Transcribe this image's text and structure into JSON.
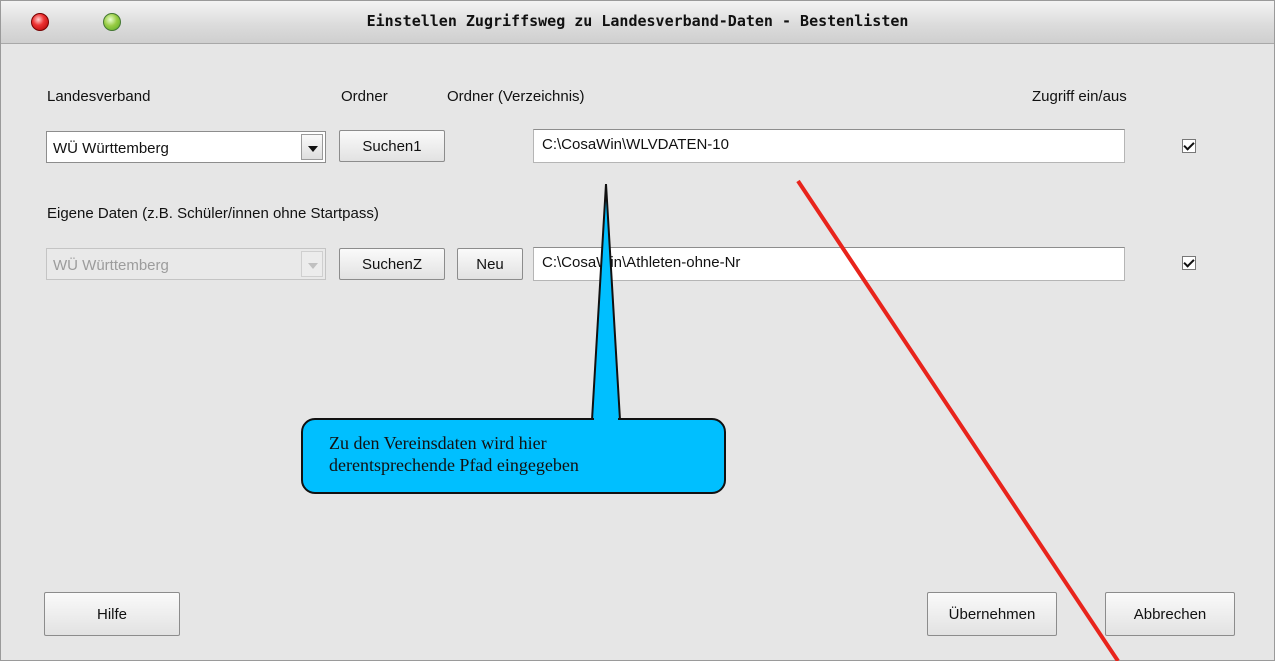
{
  "window": {
    "title": "Einstellen Zugriffsweg zu Landesverband-Daten  - Bestenlisten"
  },
  "headers": {
    "landesverband": "Landesverband",
    "ordner": "Ordner",
    "ordner_verzeichnis": "Ordner (Verzeichnis)",
    "zugriff": "Zugriff ein/aus"
  },
  "row1": {
    "landesverband_value": "WÜ Württemberg",
    "search_button": "Suchen1",
    "path": "C:\\CosaWin\\WLVDATEN-10",
    "access_checked": true
  },
  "section_label": "Eigene Daten (z.B. Schüler/innen ohne Startpass)",
  "row2": {
    "landesverband_value": "WÜ Württemberg",
    "search_button": "SuchenZ",
    "new_button": "Neu",
    "path": "C:\\CosaWin\\Athleten-ohne-Nr",
    "access_checked": true
  },
  "callout": {
    "line1": "Zu den Vereinsdaten wird hier",
    "line2": "derentsprechende Pfad eingegeben",
    "fill_color": "#00bfff"
  },
  "footer": {
    "help_button": "Hilfe",
    "apply_button": "Übernehmen",
    "cancel_button": "Abbrechen"
  },
  "annotation_color": "#e8241c"
}
